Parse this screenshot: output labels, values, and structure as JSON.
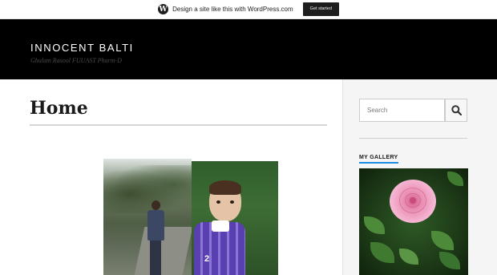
{
  "wordpress_bar": {
    "logo_glyph": "W",
    "text": "Design a site like this with WordPress.com",
    "button_label": "Get started"
  },
  "header": {
    "site_title": "INNOCENT BALTI",
    "tagline": "Ghulam Rasool FUUAST Pharm-D"
  },
  "main": {
    "page_title": "Home",
    "photo_jersey_text": "2"
  },
  "sidebar": {
    "search_placeholder": "Search",
    "gallery_title": "MY GALLERY"
  },
  "colors": {
    "header_bg": "#000000",
    "sidebar_bg": "#f5f5f5",
    "widget_accent": "#1b8be0"
  }
}
